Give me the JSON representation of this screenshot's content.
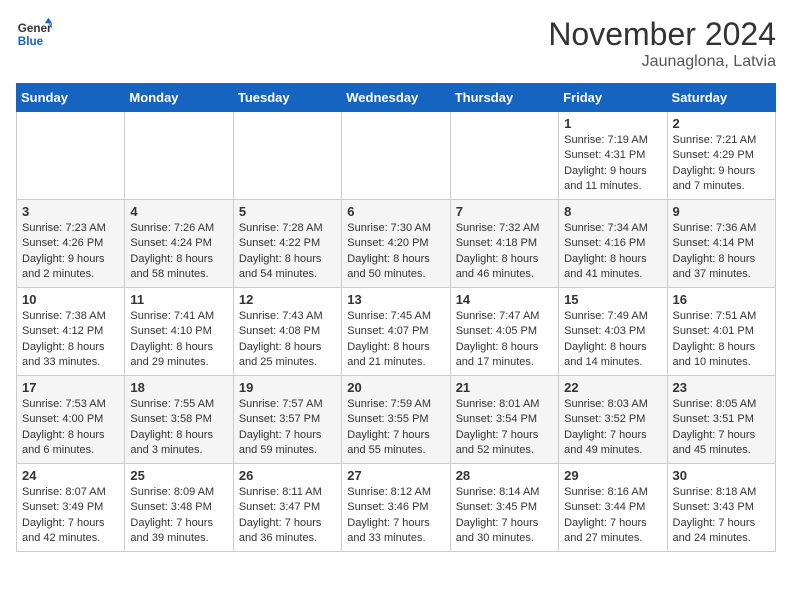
{
  "logo": {
    "line1": "General",
    "line2": "Blue"
  },
  "title": "November 2024",
  "location": "Jaunaglona, Latvia",
  "days_header": [
    "Sunday",
    "Monday",
    "Tuesday",
    "Wednesday",
    "Thursday",
    "Friday",
    "Saturday"
  ],
  "weeks": [
    [
      {
        "day": "",
        "info": ""
      },
      {
        "day": "",
        "info": ""
      },
      {
        "day": "",
        "info": ""
      },
      {
        "day": "",
        "info": ""
      },
      {
        "day": "",
        "info": ""
      },
      {
        "day": "1",
        "info": "Sunrise: 7:19 AM\nSunset: 4:31 PM\nDaylight: 9 hours and 11 minutes."
      },
      {
        "day": "2",
        "info": "Sunrise: 7:21 AM\nSunset: 4:29 PM\nDaylight: 9 hours and 7 minutes."
      }
    ],
    [
      {
        "day": "3",
        "info": "Sunrise: 7:23 AM\nSunset: 4:26 PM\nDaylight: 9 hours and 2 minutes."
      },
      {
        "day": "4",
        "info": "Sunrise: 7:26 AM\nSunset: 4:24 PM\nDaylight: 8 hours and 58 minutes."
      },
      {
        "day": "5",
        "info": "Sunrise: 7:28 AM\nSunset: 4:22 PM\nDaylight: 8 hours and 54 minutes."
      },
      {
        "day": "6",
        "info": "Sunrise: 7:30 AM\nSunset: 4:20 PM\nDaylight: 8 hours and 50 minutes."
      },
      {
        "day": "7",
        "info": "Sunrise: 7:32 AM\nSunset: 4:18 PM\nDaylight: 8 hours and 46 minutes."
      },
      {
        "day": "8",
        "info": "Sunrise: 7:34 AM\nSunset: 4:16 PM\nDaylight: 8 hours and 41 minutes."
      },
      {
        "day": "9",
        "info": "Sunrise: 7:36 AM\nSunset: 4:14 PM\nDaylight: 8 hours and 37 minutes."
      }
    ],
    [
      {
        "day": "10",
        "info": "Sunrise: 7:38 AM\nSunset: 4:12 PM\nDaylight: 8 hours and 33 minutes."
      },
      {
        "day": "11",
        "info": "Sunrise: 7:41 AM\nSunset: 4:10 PM\nDaylight: 8 hours and 29 minutes."
      },
      {
        "day": "12",
        "info": "Sunrise: 7:43 AM\nSunset: 4:08 PM\nDaylight: 8 hours and 25 minutes."
      },
      {
        "day": "13",
        "info": "Sunrise: 7:45 AM\nSunset: 4:07 PM\nDaylight: 8 hours and 21 minutes."
      },
      {
        "day": "14",
        "info": "Sunrise: 7:47 AM\nSunset: 4:05 PM\nDaylight: 8 hours and 17 minutes."
      },
      {
        "day": "15",
        "info": "Sunrise: 7:49 AM\nSunset: 4:03 PM\nDaylight: 8 hours and 14 minutes."
      },
      {
        "day": "16",
        "info": "Sunrise: 7:51 AM\nSunset: 4:01 PM\nDaylight: 8 hours and 10 minutes."
      }
    ],
    [
      {
        "day": "17",
        "info": "Sunrise: 7:53 AM\nSunset: 4:00 PM\nDaylight: 8 hours and 6 minutes."
      },
      {
        "day": "18",
        "info": "Sunrise: 7:55 AM\nSunset: 3:58 PM\nDaylight: 8 hours and 3 minutes."
      },
      {
        "day": "19",
        "info": "Sunrise: 7:57 AM\nSunset: 3:57 PM\nDaylight: 7 hours and 59 minutes."
      },
      {
        "day": "20",
        "info": "Sunrise: 7:59 AM\nSunset: 3:55 PM\nDaylight: 7 hours and 55 minutes."
      },
      {
        "day": "21",
        "info": "Sunrise: 8:01 AM\nSunset: 3:54 PM\nDaylight: 7 hours and 52 minutes."
      },
      {
        "day": "22",
        "info": "Sunrise: 8:03 AM\nSunset: 3:52 PM\nDaylight: 7 hours and 49 minutes."
      },
      {
        "day": "23",
        "info": "Sunrise: 8:05 AM\nSunset: 3:51 PM\nDaylight: 7 hours and 45 minutes."
      }
    ],
    [
      {
        "day": "24",
        "info": "Sunrise: 8:07 AM\nSunset: 3:49 PM\nDaylight: 7 hours and 42 minutes."
      },
      {
        "day": "25",
        "info": "Sunrise: 8:09 AM\nSunset: 3:48 PM\nDaylight: 7 hours and 39 minutes."
      },
      {
        "day": "26",
        "info": "Sunrise: 8:11 AM\nSunset: 3:47 PM\nDaylight: 7 hours and 36 minutes."
      },
      {
        "day": "27",
        "info": "Sunrise: 8:12 AM\nSunset: 3:46 PM\nDaylight: 7 hours and 33 minutes."
      },
      {
        "day": "28",
        "info": "Sunrise: 8:14 AM\nSunset: 3:45 PM\nDaylight: 7 hours and 30 minutes."
      },
      {
        "day": "29",
        "info": "Sunrise: 8:16 AM\nSunset: 3:44 PM\nDaylight: 7 hours and 27 minutes."
      },
      {
        "day": "30",
        "info": "Sunrise: 8:18 AM\nSunset: 3:43 PM\nDaylight: 7 hours and 24 minutes."
      }
    ]
  ]
}
